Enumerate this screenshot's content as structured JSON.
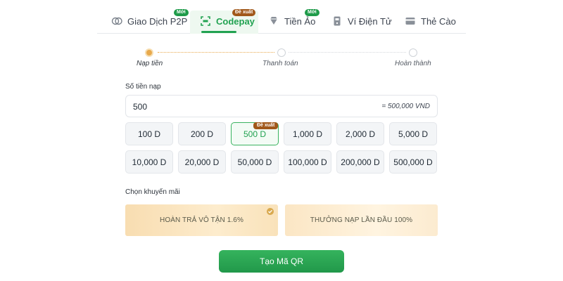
{
  "tabs": [
    {
      "label": "Giao Dịch P2P",
      "icon": "p2p-exchange-icon",
      "badge": "Mới",
      "badge_color": "#1f9b4a"
    },
    {
      "label": "Codepay",
      "icon": "qr-scan-icon",
      "badge": "Đề xuất",
      "badge_color": "#a1581a",
      "active": true
    },
    {
      "label": "Tiền Ảo",
      "icon": "diamond-icon",
      "badge": "Mới",
      "badge_color": "#1f9b4a"
    },
    {
      "label": "Ví Điện Tử",
      "icon": "wallet-icon"
    },
    {
      "label": "Thẻ Cào",
      "icon": "card-icon"
    }
  ],
  "steps": [
    {
      "label": "Nạp tiền",
      "state": "done"
    },
    {
      "label": "Thanh toán",
      "state": "pending"
    },
    {
      "label": "Hoàn thành",
      "state": "pending"
    }
  ],
  "amount": {
    "label": "Số tiền nạp",
    "value": "500",
    "equivalent": "= 500,000 VND"
  },
  "quick_amounts": [
    "100 D",
    "200 D",
    "500 D",
    "1,000 D",
    "2,000 D",
    "5,000 D",
    "10,000 D",
    "20,000 D",
    "50,000 D",
    "100,000 D",
    "200,000 D",
    "500,000 D"
  ],
  "selected_amount": "500 D",
  "selected_badge": "Đề xuất",
  "promotion": {
    "label": "Chọn khuyến mãi",
    "options": [
      {
        "label": "HOÀN TRẢ VÔ TẬN 1.6%",
        "selected": true
      },
      {
        "label": "THƯỞNG NẠP LẦN ĐẦU 100%",
        "selected": false
      }
    ]
  },
  "submit_label": "Tạo Mã QR",
  "colors": {
    "accent": "#21a251",
    "badge_new": "#1f9b4a",
    "badge_recommended": "#a1581a",
    "step_done": "#e8a94c"
  }
}
